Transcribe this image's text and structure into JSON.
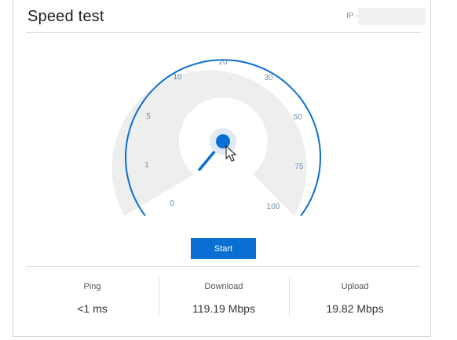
{
  "header": {
    "title": "Speed test",
    "ip_label": "IP -",
    "ip_value": ""
  },
  "gauge": {
    "tick_labels": [
      "0",
      "1",
      "5",
      "10",
      "20",
      "30",
      "50",
      "75",
      "100"
    ],
    "needle_value": "0",
    "accent_color": "#0a6fd2",
    "face_color": "#eeeeee"
  },
  "controls": {
    "start_label": "Start"
  },
  "stats": {
    "ping": {
      "label": "Ping",
      "value": "<1 ms"
    },
    "download": {
      "label": "Download",
      "value": "119.19 Mbps"
    },
    "upload": {
      "label": "Upload",
      "value": "19.82 Mbps"
    }
  },
  "icons": {
    "cursor": "mouse-pointer-icon"
  }
}
